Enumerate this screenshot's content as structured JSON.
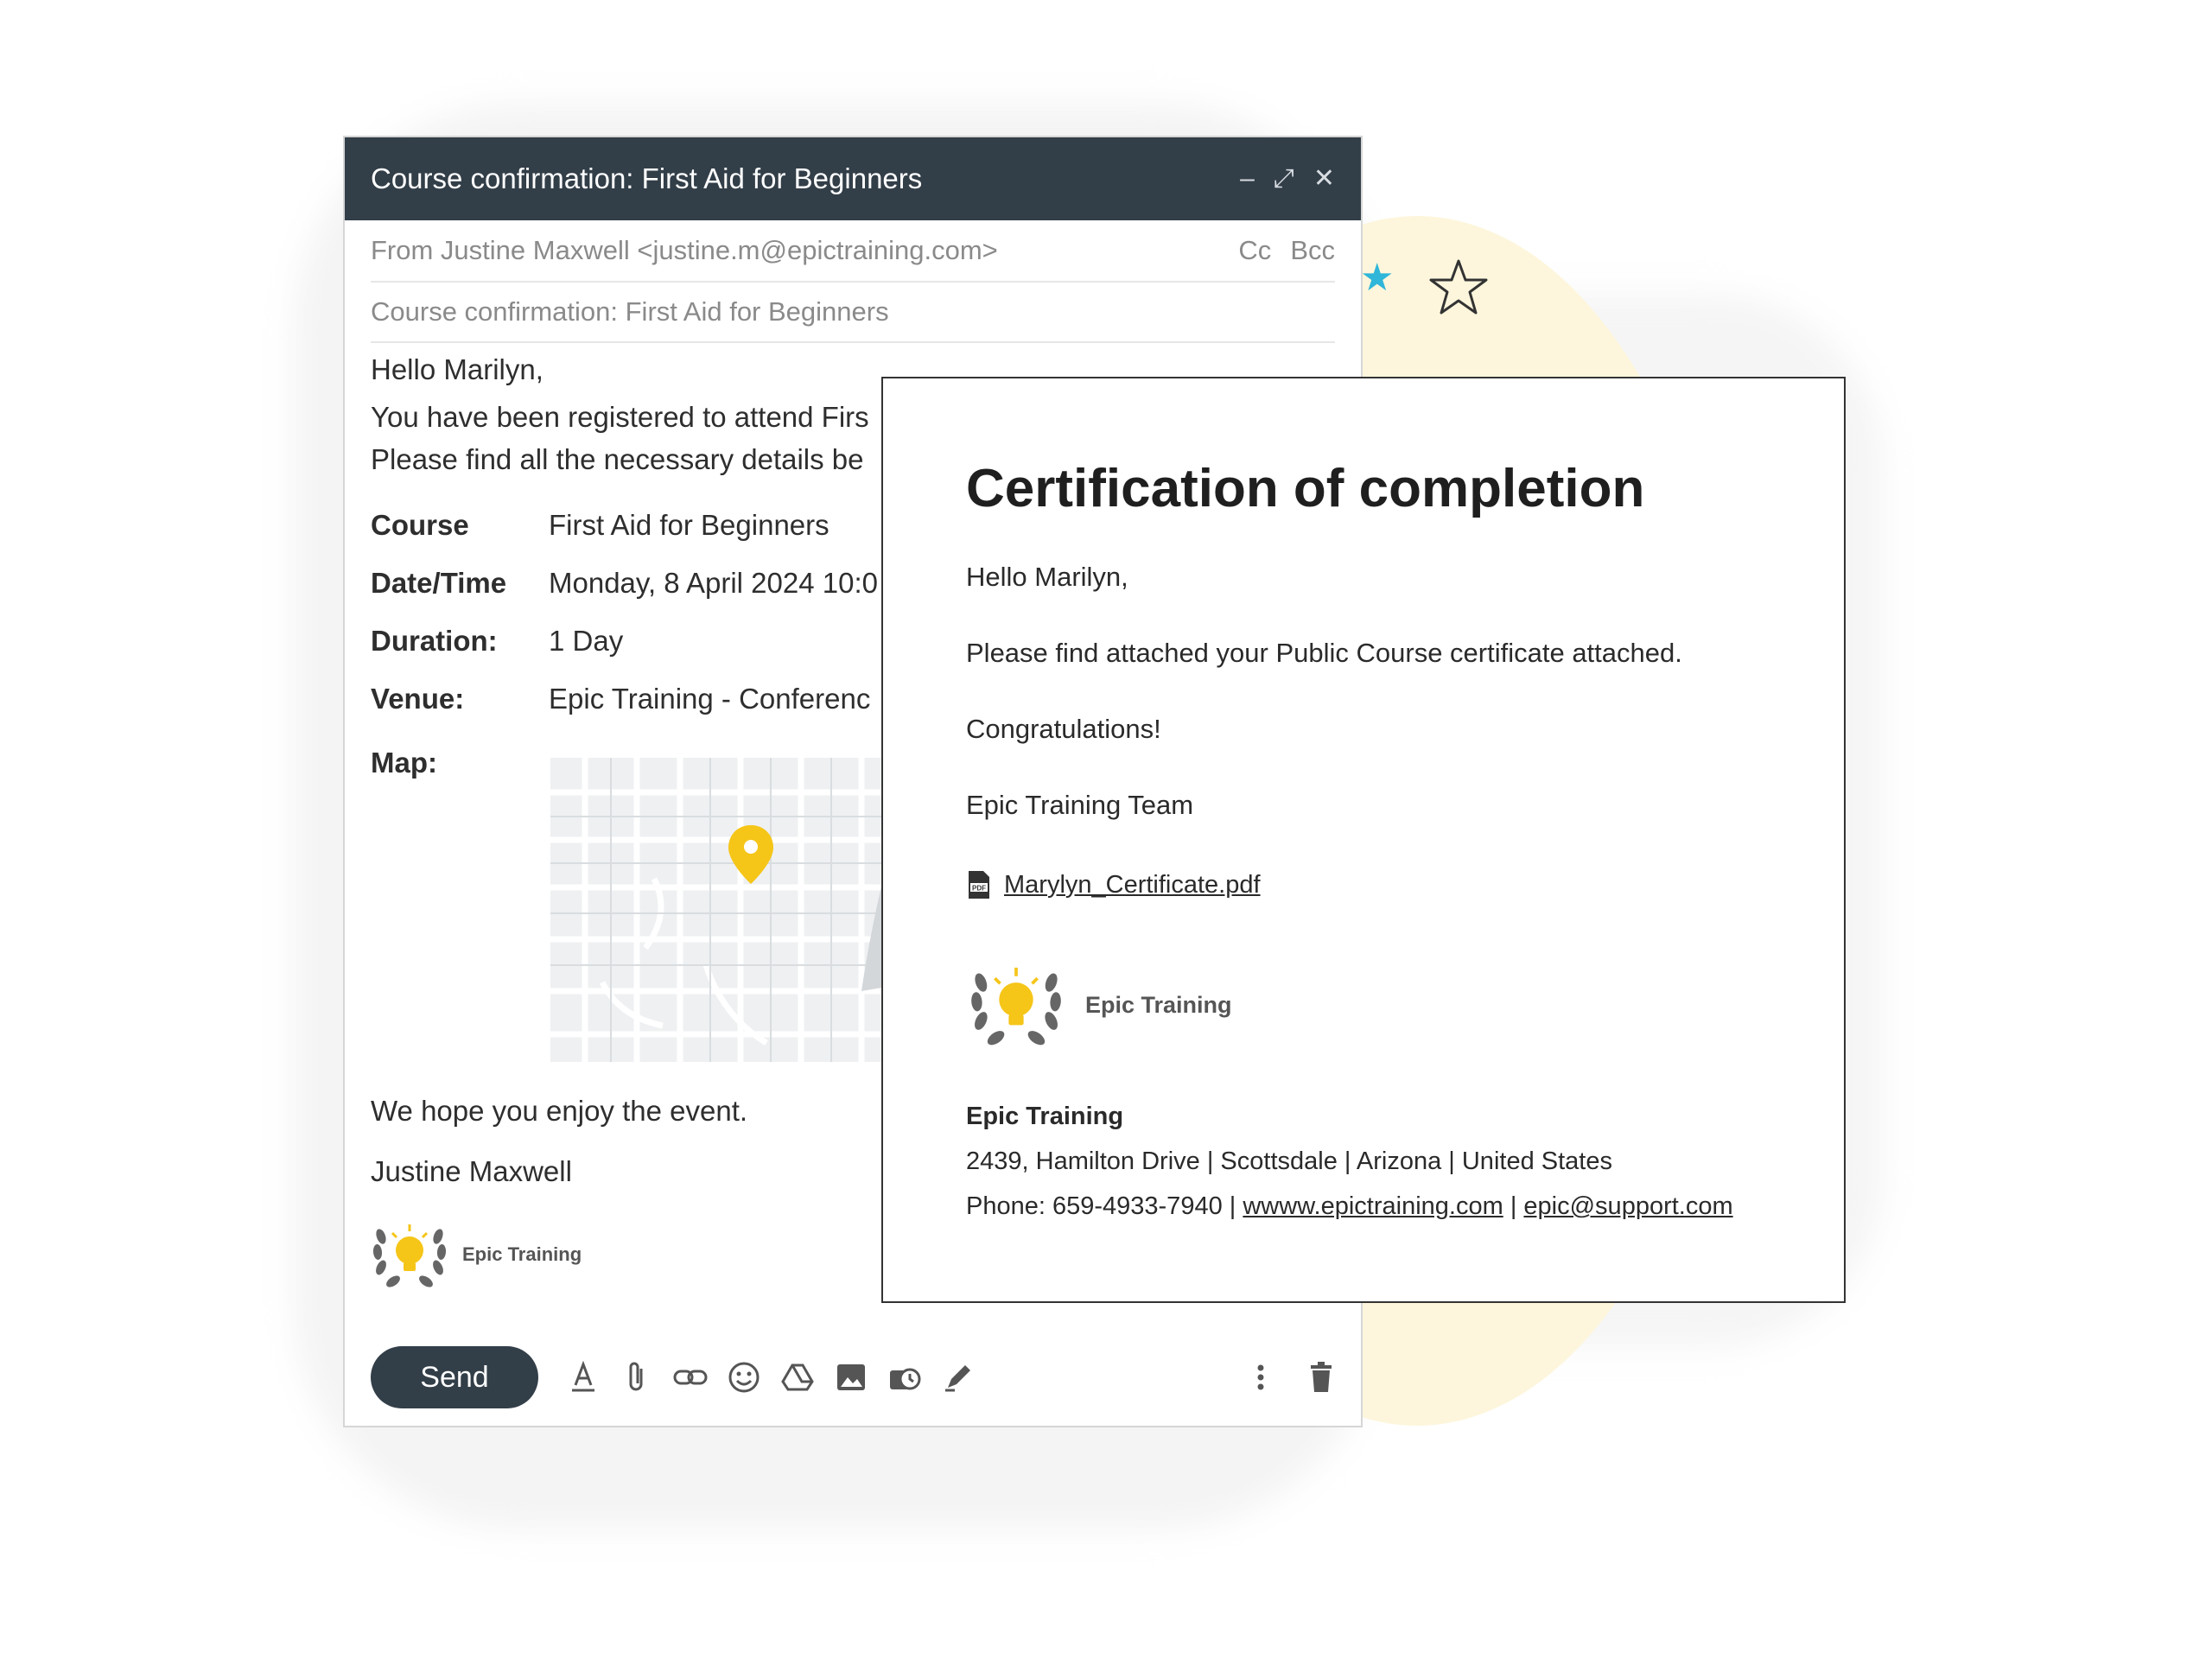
{
  "compose": {
    "title": "Course confirmation: First Aid for Beginners",
    "from": "From Justine Maxwell <justine.m@epictraining.com>",
    "cc": "Cc",
    "bcc": "Bcc",
    "subject": "Course confirmation: First Aid for Beginners",
    "body": {
      "greeting": "Hello Marilyn,",
      "line1": "You have been registered to attend Firs",
      "line2": "Please find all the necessary details be",
      "details": [
        {
          "label": "Course",
          "value": "First Aid for Beginners"
        },
        {
          "label": "Date/Time",
          "value": "Monday, 8 April 2024 10:0"
        },
        {
          "label": "Duration:",
          "value": "1 Day"
        },
        {
          "label": "Venue:",
          "value": "Epic Training - Conferenc"
        }
      ],
      "map_label": "Map:",
      "closing": "We hope you enjoy the event.",
      "signature": "Justine Maxwell",
      "logo_name": "Epic Training"
    },
    "send_label": "Send"
  },
  "certificate": {
    "title": "Certification of completion",
    "greeting": "Hello Marilyn,",
    "message": "Please find attached your Public Course certificate attached.",
    "congrats": "Congratulations!",
    "team": "Epic Training Team",
    "attachment": "Marylyn_Certificate.pdf",
    "logo_name": "Epic Training",
    "company": "Epic Training",
    "address": "2439, Hamilton Drive | Scottsdale | Arizona | United States",
    "phone": "Phone: 659-4933-7940 |",
    "website": "wwww.epictraining.com",
    "separator": "|",
    "email": "epic@support.com"
  },
  "colors": {
    "header": "#323e48",
    "accent_yellow": "#f5c518",
    "star_blue": "#2fb6d9"
  }
}
